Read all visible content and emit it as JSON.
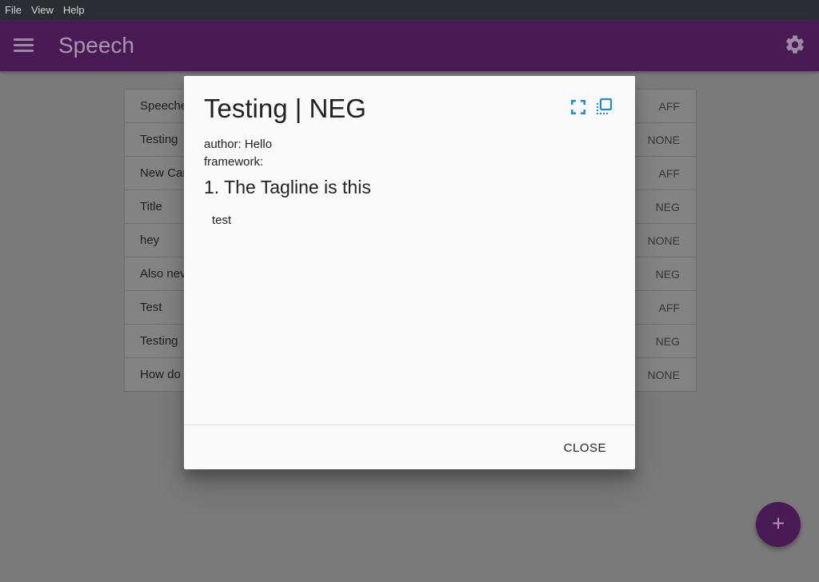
{
  "menubar": {
    "items": [
      "File",
      "View",
      "Help"
    ]
  },
  "appbar": {
    "title": "Speech"
  },
  "list": {
    "rows": [
      {
        "title": "Speeche",
        "side": "AFF"
      },
      {
        "title": "Testing",
        "side": "NONE"
      },
      {
        "title": "New Car",
        "side": "AFF"
      },
      {
        "title": "Title",
        "side": "NEG"
      },
      {
        "title": "hey",
        "side": "NONE"
      },
      {
        "title": "Also nev",
        "side": "NEG"
      },
      {
        "title": "Test",
        "side": "AFF"
      },
      {
        "title": "Testing",
        "side": "NEG"
      },
      {
        "title": "How do",
        "side": "NONE"
      }
    ]
  },
  "dialog": {
    "title": "Testing | NEG",
    "author_line": "author: Hello",
    "framework_line": "framework:",
    "tagline": "1. The Tagline is this",
    "card_text": "test",
    "close_label": "CLOSE"
  },
  "colors": {
    "accent": "#4a1a55",
    "icon_blue": "#1a8fd6"
  },
  "fab": {
    "label": "+"
  }
}
